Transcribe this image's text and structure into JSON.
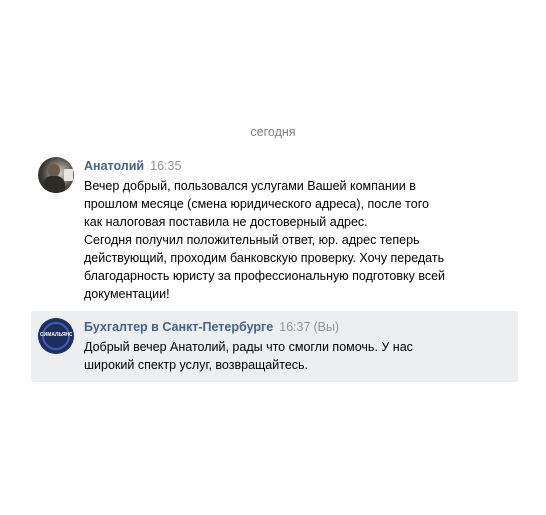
{
  "chat": {
    "date_separator": "сегодня",
    "messages": [
      {
        "author": "Анатолий",
        "time": "16:35",
        "lines": [
          "Вечер добрый, пользовался услугами Вашей компании в",
          "прошлом месяце (смена юридического адреса), после того",
          "как налоговая поставила не достоверный адрес.",
          "Сегодня получил положительный ответ, юр. адрес теперь",
          "действующий, проходим банковскую проверку. Хочу передать",
          "благодарность юристу за профессиональную подготовку всей",
          "документации!"
        ]
      },
      {
        "author": "Бухгалтер в Санкт-Петербурге",
        "time": "16:37",
        "you_label": "(Вы)",
        "avatar_logo_text": "СИМАЛЬЯНС",
        "lines": [
          "Добрый вечер Анатолий, рады что смогли помочь. У нас",
          "широкий спектр услуг, возвращайтесь."
        ]
      }
    ]
  },
  "colors": {
    "author": "#42648b",
    "timestamp": "#939393",
    "highlight_background": "#edeef0"
  }
}
